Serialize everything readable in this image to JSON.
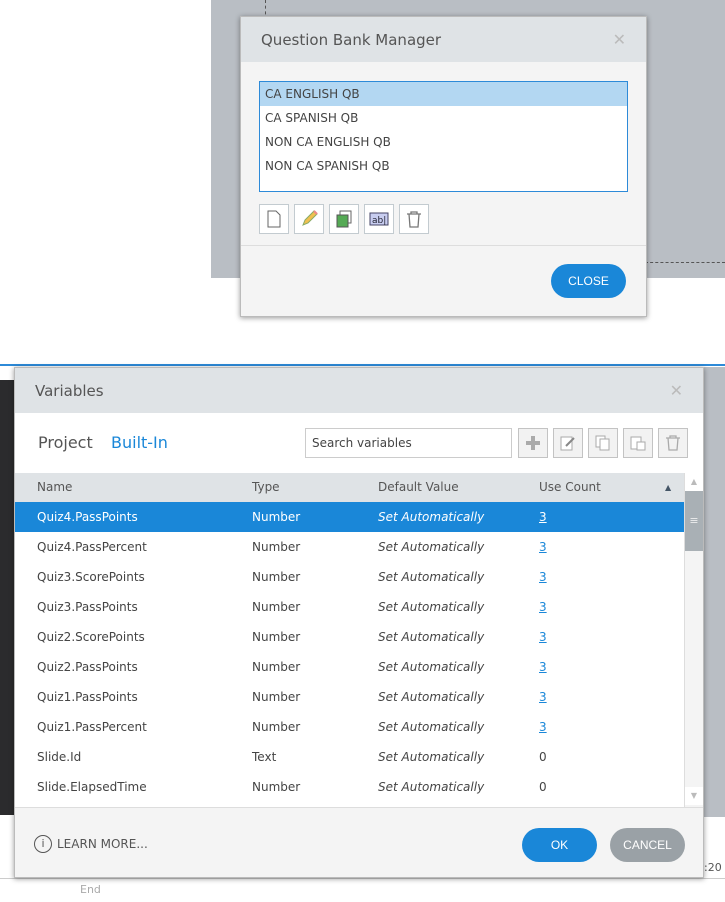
{
  "background": {
    "timeline_end_label": "End",
    "timeline_time": ":20"
  },
  "question_bank": {
    "title": "Question Bank Manager",
    "items": [
      "CA ENGLISH QB",
      "CA SPANISH QB",
      "NON CA ENGLISH QB",
      "NON CA SPANISH QB"
    ],
    "selected_index": 0,
    "close_label": "CLOSE"
  },
  "variables": {
    "title": "Variables",
    "tabs": [
      "Project",
      "Built-In"
    ],
    "search_placeholder": "Search variables",
    "columns": [
      "Name",
      "Type",
      "Default Value",
      "Use Count"
    ],
    "rows": [
      {
        "name": "Quiz4.PassPoints",
        "type": "Number",
        "default": "Set Automatically",
        "count": "3",
        "link": true
      },
      {
        "name": "Quiz4.PassPercent",
        "type": "Number",
        "default": "Set Automatically",
        "count": "3",
        "link": true
      },
      {
        "name": "Quiz3.ScorePoints",
        "type": "Number",
        "default": "Set Automatically",
        "count": "3",
        "link": true
      },
      {
        "name": "Quiz3.PassPoints",
        "type": "Number",
        "default": "Set Automatically",
        "count": "3",
        "link": true
      },
      {
        "name": "Quiz2.ScorePoints",
        "type": "Number",
        "default": "Set Automatically",
        "count": "3",
        "link": true
      },
      {
        "name": "Quiz2.PassPoints",
        "type": "Number",
        "default": "Set Automatically",
        "count": "3",
        "link": true
      },
      {
        "name": "Quiz1.PassPoints",
        "type": "Number",
        "default": "Set Automatically",
        "count": "3",
        "link": true
      },
      {
        "name": "Quiz1.PassPercent",
        "type": "Number",
        "default": "Set Automatically",
        "count": "3",
        "link": true
      },
      {
        "name": "Slide.Id",
        "type": "Text",
        "default": "Set Automatically",
        "count": "0",
        "link": false
      },
      {
        "name": "Slide.ElapsedTime",
        "type": "Number",
        "default": "Set Automatically",
        "count": "0",
        "link": false
      }
    ],
    "learn_more": "LEARN MORE...",
    "ok_label": "OK",
    "cancel_label": "CANCEL"
  },
  "colors": {
    "accent": "#1a87d8",
    "header": "#dfe3e6"
  }
}
